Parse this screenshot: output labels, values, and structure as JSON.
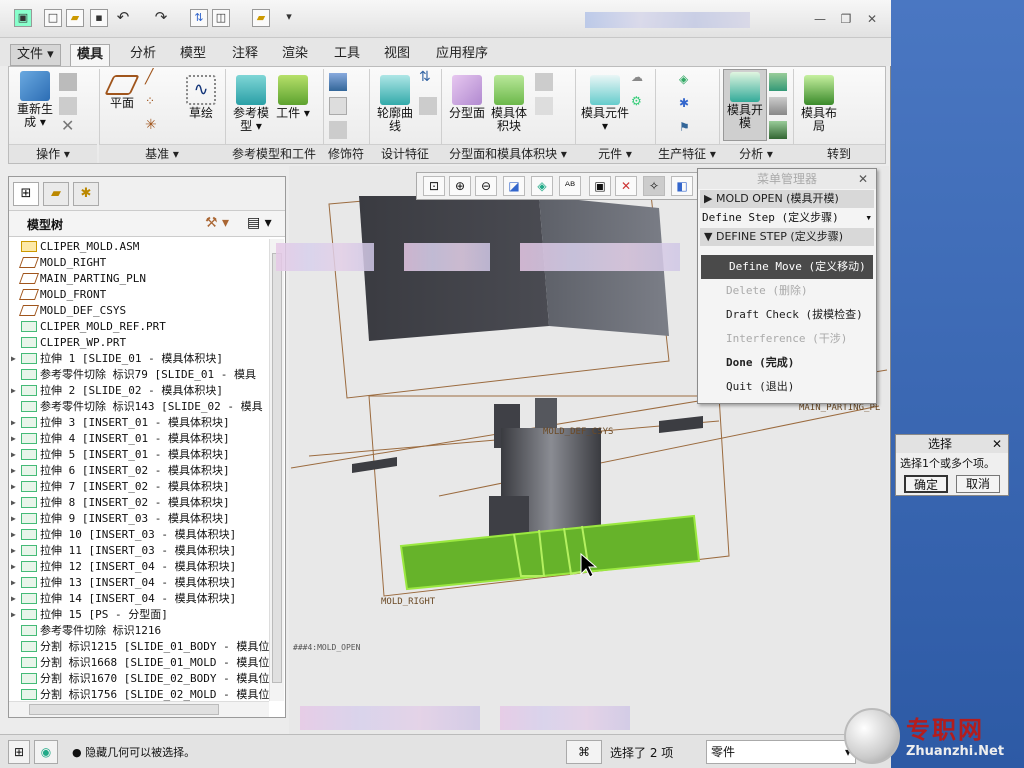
{
  "window": {
    "blurred_title": ""
  },
  "tabs": [
    {
      "label": "文件",
      "x": "file"
    },
    {
      "label": "模具",
      "x": "active"
    },
    {
      "label": "分析"
    },
    {
      "label": "模型"
    },
    {
      "label": "注释"
    },
    {
      "label": "渲染"
    },
    {
      "label": "工具"
    },
    {
      "label": "视图"
    },
    {
      "label": "应用程序"
    }
  ],
  "ribbon": {
    "buttons": {
      "regen": "重新生成",
      "plane": "平面",
      "sketch": "草绘",
      "ref_model": "参考模型",
      "workpiece": "工件",
      "silhouette": "轮廓曲线",
      "parting_surface": "分型面",
      "mold_volume": "模具体积块",
      "mold_component": "模具元件",
      "mold_open": "模具开模",
      "mold_layout": "模具布局"
    },
    "groups": [
      "操作",
      "基准",
      "参考模型和工件",
      "修饰符",
      "设计特征",
      "分型面和模具体积块",
      "元件",
      "生产特征",
      "分析",
      "转到"
    ]
  },
  "left_panel": {
    "tree_title": "模型树",
    "items": [
      {
        "label": "CLIPER_MOLD.ASM",
        "exp": ""
      },
      {
        "label": "MOLD_RIGHT",
        "exp": ""
      },
      {
        "label": "MAIN_PARTING_PLN",
        "exp": ""
      },
      {
        "label": "MOLD_FRONT",
        "exp": ""
      },
      {
        "label": "MOLD_DEF_CSYS",
        "exp": ""
      },
      {
        "label": "CLIPER_MOLD_REF.PRT",
        "exp": ""
      },
      {
        "label": "CLIPER_WP.PRT",
        "exp": ""
      },
      {
        "label": "拉伸 1 [SLIDE_01 - 模具体积块]",
        "exp": "▶"
      },
      {
        "label": "参考零件切除 标识79 [SLIDE_01 - 模具",
        "exp": ""
      },
      {
        "label": "拉伸 2 [SLIDE_02 - 模具体积块]",
        "exp": "▶"
      },
      {
        "label": "参考零件切除 标识143 [SLIDE_02 - 模具",
        "exp": ""
      },
      {
        "label": "拉伸 3 [INSERT_01 - 模具体积块]",
        "exp": "▶"
      },
      {
        "label": "拉伸 4 [INSERT_01 - 模具体积块]",
        "exp": "▶"
      },
      {
        "label": "拉伸 5 [INSERT_01 - 模具体积块]",
        "exp": "▶"
      },
      {
        "label": "拉伸 6 [INSERT_02 - 模具体积块]",
        "exp": "▶"
      },
      {
        "label": "拉伸 7 [INSERT_02 - 模具体积块]",
        "exp": "▶"
      },
      {
        "label": "拉伸 8 [INSERT_02 - 模具体积块]",
        "exp": "▶"
      },
      {
        "label": "拉伸 9 [INSERT_03 - 模具体积块]",
        "exp": "▶"
      },
      {
        "label": "拉伸 10 [INSERT_03 - 模具体积块]",
        "exp": "▶"
      },
      {
        "label": "拉伸 11 [INSERT_03 - 模具体积块]",
        "exp": "▶"
      },
      {
        "label": "拉伸 12 [INSERT_04 - 模具体积块]",
        "exp": "▶"
      },
      {
        "label": "拉伸 13 [INSERT_04 - 模具体积块]",
        "exp": "▶"
      },
      {
        "label": "拉伸 14 [INSERT_04 - 模具体积块]",
        "exp": "▶"
      },
      {
        "label": "拉伸 15 [PS - 分型面]",
        "exp": "▶"
      },
      {
        "label": "参考零件切除 标识1216",
        "exp": ""
      },
      {
        "label": "分割 标识1215 [SLIDE_01_BODY - 模具位",
        "exp": ""
      },
      {
        "label": "分割 标识1668 [SLIDE_01_MOLD - 模具位",
        "exp": ""
      },
      {
        "label": "分割 标识1670 [SLIDE_02_BODY - 模具位",
        "exp": ""
      },
      {
        "label": "分割 标识1756 [SLIDE_02_MOLD - 模具位",
        "exp": ""
      }
    ]
  },
  "graphics": {
    "labels": {
      "csys": "MOLD_DEF_CSYS",
      "right": "MOLD_RIGHT",
      "parting": "MAIN_PARTING_PL",
      "mode": "###4:MOLD_OPEN"
    }
  },
  "menu_manager": {
    "title": "菜单管理器",
    "header1": "MOLD OPEN (模具开模)",
    "dropdown": "Define Step (定义步骤)",
    "header2": "DEFINE STEP (定义步骤)",
    "items": [
      {
        "label": "Define Move (定义移动)",
        "state": "sel"
      },
      {
        "label": "Delete (删除)",
        "state": "dis"
      },
      {
        "label": "Draft Check (拔模检查)",
        "state": ""
      },
      {
        "label": "Interference (干涉)",
        "state": "dis"
      },
      {
        "label": "Done (完成)",
        "state": "bold"
      },
      {
        "label": "Quit (退出)",
        "state": ""
      }
    ]
  },
  "select_dialog": {
    "title": "选择",
    "message": "选择1个或多个项。",
    "ok": "确定",
    "cancel": "取消"
  },
  "status": {
    "message": "隐藏几何可以被选择。",
    "selected": "选择了 2 项",
    "filter": "零件"
  },
  "watermark": {
    "name": "专职网",
    "url": "Zhuanzhi.Net"
  },
  "colors": {
    "highlight": "#7fd61f",
    "part_dark": "#3f4046",
    "frame": "#9b6b3f"
  }
}
